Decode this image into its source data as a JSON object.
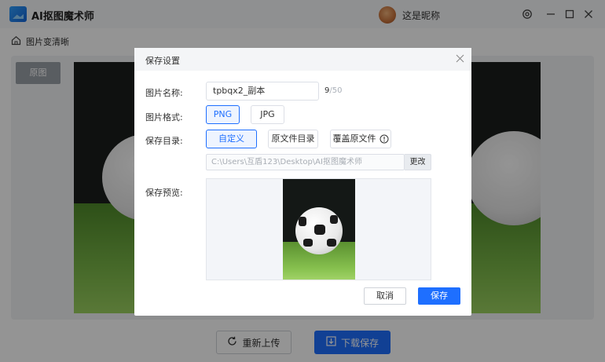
{
  "app": {
    "title": "AI抠图魔术师",
    "username": "这是昵称",
    "icons": [
      "logo-icon",
      "avatar",
      "settings-icon",
      "minimize-icon",
      "maximize-icon",
      "close-icon"
    ]
  },
  "breadcrumb": {
    "icon": "home-icon",
    "label": "图片变清晰"
  },
  "canvas": {
    "tab_original": "原图"
  },
  "bottom_actions": {
    "reupload": {
      "label": "重新上传",
      "icon": "refresh-icon"
    },
    "download": {
      "label": "下载保存",
      "icon": "download-icon"
    }
  },
  "dialog": {
    "title": "保存设置",
    "name_label": "图片名称:",
    "name_value": "tpbqx2_副本",
    "char_count": "9",
    "char_max": "/50",
    "format_label": "图片格式:",
    "formats": [
      "PNG",
      "JPG"
    ],
    "selected_format": "PNG",
    "dir_label": "保存目录:",
    "dir_options": [
      "自定义",
      "原文件目录",
      "覆盖原文件"
    ],
    "selected_dir": "自定义",
    "path_value": "C:\\Users\\互盾123\\Desktop\\AI抠图魔术师",
    "change_label": "更改",
    "preview_label": "保存预览:",
    "cancel_label": "取消",
    "save_label": "保存"
  },
  "colors": {
    "accent": "#1e6fff",
    "overlay": "rgba(0,0,0,0.42)"
  }
}
